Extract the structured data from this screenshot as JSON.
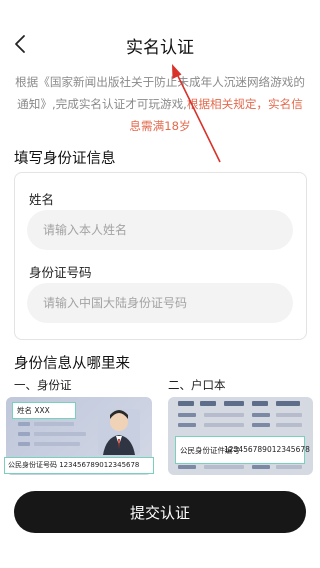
{
  "header": {
    "title": "实名认证"
  },
  "notice": {
    "text_plain": "根据《国家新闻出版社关于防止未成年人沉迷网络游戏的通知》,完成实名认证才可玩游戏,",
    "text_highlight": "根据相关规定，实名信息需满18岁"
  },
  "form": {
    "section_title": "填写身份证信息",
    "name_label": "姓名",
    "name_placeholder": "请输入本人姓名",
    "id_label": "身份证号码",
    "id_placeholder": "请输入中国大陆身份证号码"
  },
  "source": {
    "section_title": "身份信息从哪里来",
    "id_card_label": "一、身份证",
    "hukou_label": "二、户口本",
    "id_card_name_tag": "姓名 XXX",
    "id_card_number_tag": "公民身份证号码 123456789012345678",
    "hukou_key": "公民身份证件编号",
    "hukou_value": "123456789012345678"
  },
  "actions": {
    "submit_label": "提交认证"
  },
  "colors": {
    "accent_red": "#e36a4d",
    "button_bg": "#171717",
    "tag_border": "#79d0bd"
  }
}
